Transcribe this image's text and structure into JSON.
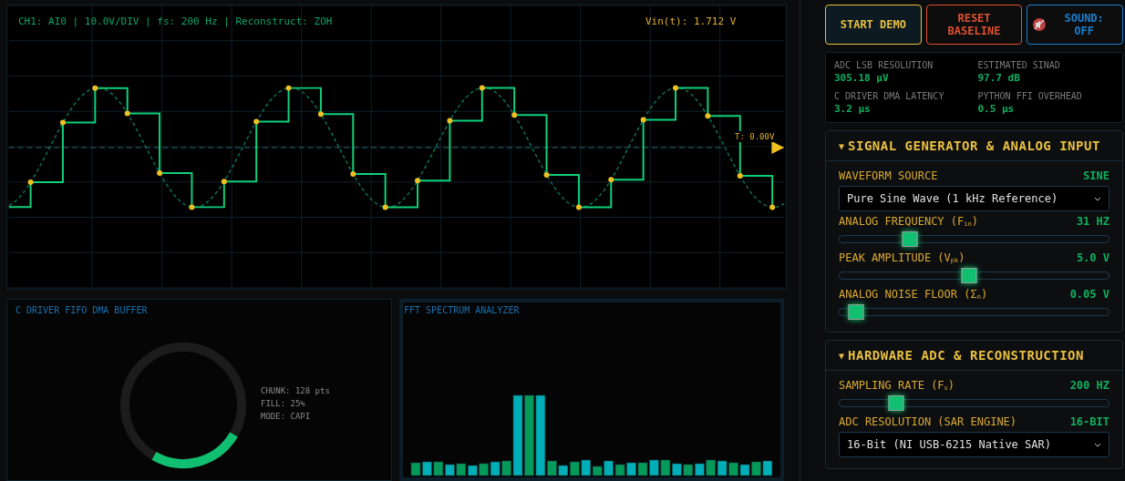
{
  "scope": {
    "header": "CH1: AI0 | 10.0V/DIV | fs: 200 Hz | Reconstruct: ZOH",
    "readout": "Vin(t): 1.712 V",
    "trigger_label": "T: 0.00V"
  },
  "buffer": {
    "title": "C DRIVER FIFO DMA BUFFER",
    "level": 0.25,
    "stats": [
      "CHUNK: 128 pts",
      "FILL: 25%",
      "MODE: CAPI"
    ]
  },
  "fft": {
    "title": "FFT SPECTRUM ANALYZER"
  },
  "buttons": [
    {
      "label": "START DEMO",
      "kind": "start"
    },
    {
      "label": "RESET BASELINE",
      "kind": "reset"
    },
    {
      "label": "SOUND: OFF",
      "kind": "sound"
    }
  ],
  "metrics": [
    {
      "label": "ADC LSB RESOLUTION",
      "value": "305.18 µV"
    },
    {
      "label": "ESTIMATED SINAD",
      "value": "97.7 dB"
    },
    {
      "label": "C DRIVER DMA LATENCY",
      "value": "3.2 µs"
    },
    {
      "label": "PYTHON FFI OVERHEAD",
      "value": "0.5 µs"
    }
  ],
  "sections": [
    {
      "arrow": "▼",
      "title": "SIGNAL GENERATOR & ANALOG INPUT",
      "controls": [
        {
          "kind": "select",
          "label": "WAVEFORM SOURCE",
          "reading": "SINE",
          "value": "Pure Sine Wave (1 kHz Reference)"
        },
        {
          "kind": "slider",
          "label": "ANALOG FREQUENCY (F$_{in}$)",
          "reading": "31 HZ",
          "level": 0.26
        },
        {
          "kind": "slider",
          "label": "PEAK AMPLITUDE (V$_{pk}$)",
          "reading": "5.0 V",
          "level": 0.48
        },
        {
          "kind": "slider",
          "label": "ANALOG NOISE FLOOR (Σ$_{n}$)",
          "reading": "0.05 V",
          "level": 0.06
        }
      ]
    },
    {
      "arrow": "▼",
      "title": "HARDWARE ADC & RECONSTRUCTION",
      "controls": [
        {
          "kind": "slider",
          "label": "SAMPLING RATE (F$_{s}$)",
          "reading": "200 HZ",
          "level": 0.21
        },
        {
          "kind": "select",
          "label": "ADC RESOLUTION (SAR ENGINE)",
          "reading": "16-BIT",
          "value": "16-Bit (NI USB-6215 Native SAR)"
        }
      ]
    }
  ]
}
